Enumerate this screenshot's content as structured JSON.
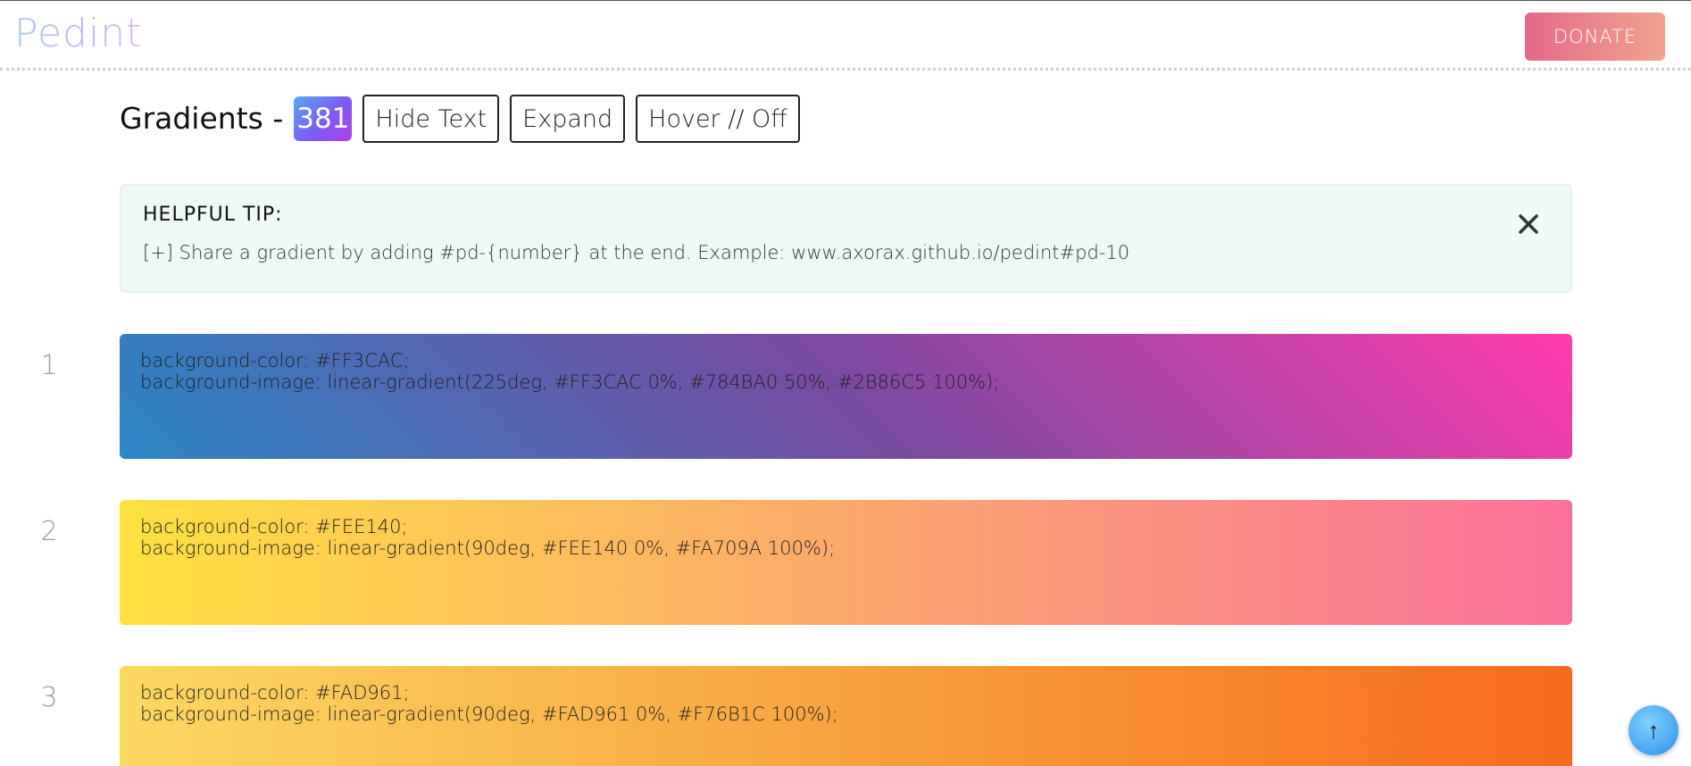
{
  "header": {
    "brand": "Pedint",
    "donate_label": "DONATE"
  },
  "toolbar": {
    "title": "Gradients -",
    "count": "381",
    "hide_text_label": "Hide Text",
    "expand_label": "Expand",
    "hover_label": "Hover // Off"
  },
  "tip": {
    "title": "HELPFUL TIP:",
    "text": "[+] Share a gradient by adding #pd-{number} at the end. Example: www.axorax.github.io/pedint#pd-10",
    "close_icon": "close-icon"
  },
  "gradients": [
    {
      "number": "1",
      "line1": "background-color: #FF3CAC;",
      "line2": "background-image: linear-gradient(225deg, #FF3CAC 0%, #784BA0 50%, #2B86C5 100%);"
    },
    {
      "number": "2",
      "line1": "background-color: #FEE140;",
      "line2": "background-image: linear-gradient(90deg, #FEE140 0%, #FA709A 100%);"
    },
    {
      "number": "3",
      "line1": "background-color: #FAD961;",
      "line2": "background-image: linear-gradient(90deg, #FAD961 0%, #F76B1C 100%);"
    }
  ],
  "scroll_top": {
    "icon": "arrow-up-icon",
    "glyph": "↑"
  },
  "colors": {
    "donate_start": "#E56A8A",
    "donate_end": "#F0A48D",
    "tip_bg": "#EDF9F2"
  }
}
